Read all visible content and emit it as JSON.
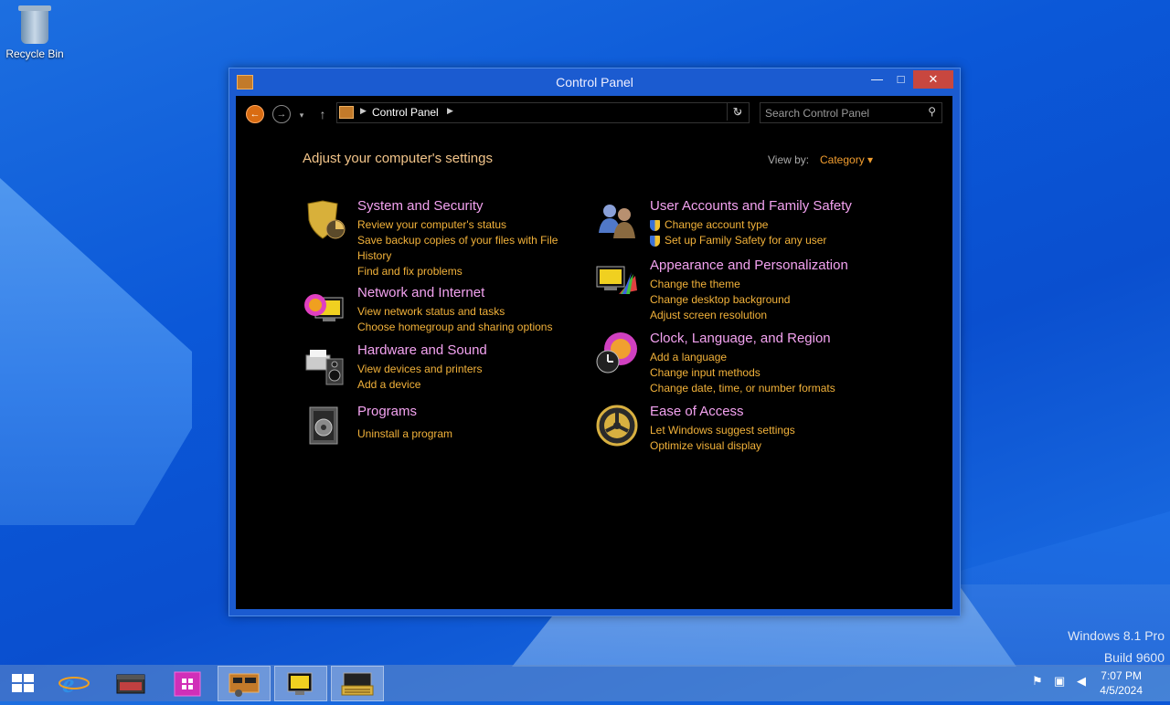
{
  "desktop": {
    "icons": [
      {
        "label": "Recycle Bin",
        "icon": "recycle-bin-icon"
      }
    ],
    "watermark": {
      "line1": "Windows 8.1 Pro",
      "line2": "Build 9600"
    }
  },
  "window": {
    "title": "Control Panel",
    "controls": {
      "minimize": "—",
      "maximize": "□",
      "close": "✕"
    },
    "nav": {
      "back": "←",
      "forward": "→",
      "recent": "▾",
      "up": "↑",
      "breadcrumb": "Control Panel",
      "search_placeholder": "Search Control Panel"
    },
    "heading": "Adjust your computer's settings",
    "view_by": {
      "label": "View by:",
      "value": "Category"
    },
    "categories_left": [
      {
        "title": "System and Security",
        "icon": "shield-icon",
        "links": [
          "Review your computer's status",
          "Save backup copies of your files with File History",
          "Find and fix problems"
        ]
      },
      {
        "title": "Network and Internet",
        "icon": "globe-network-icon",
        "links": [
          "View network status and tasks",
          "Choose homegroup and sharing options"
        ]
      },
      {
        "title": "Hardware and Sound",
        "icon": "printer-speaker-icon",
        "links": [
          "View devices and printers",
          "Add a device"
        ]
      },
      {
        "title": "Programs",
        "icon": "programs-icon",
        "links": [
          "Uninstall a program"
        ]
      }
    ],
    "categories_right": [
      {
        "title": "User Accounts and Family Safety",
        "icon": "users-icon",
        "links": [
          "Change account type",
          "Set up Family Safety for any user"
        ]
      },
      {
        "title": "Appearance and Personalization",
        "icon": "display-palette-icon",
        "links": [
          "Change the theme",
          "Change desktop background",
          "Adjust screen resolution"
        ]
      },
      {
        "title": "Clock, Language, and Region",
        "icon": "clock-globe-icon",
        "links": [
          "Add a language",
          "Change input methods",
          "Change date, time, or number formats"
        ]
      },
      {
        "title": "Ease of Access",
        "icon": "ease-of-access-icon",
        "links": [
          "Let Windows suggest settings",
          "Optimize visual display"
        ]
      }
    ]
  },
  "taskbar": {
    "items": [
      "start-icon",
      "internet-explorer-icon",
      "file-explorer-icon",
      "store-icon",
      "control-panel-icon",
      "personalization-icon",
      "keyboard-icon"
    ],
    "time": "7:07 PM",
    "date": "4/5/2024"
  }
}
